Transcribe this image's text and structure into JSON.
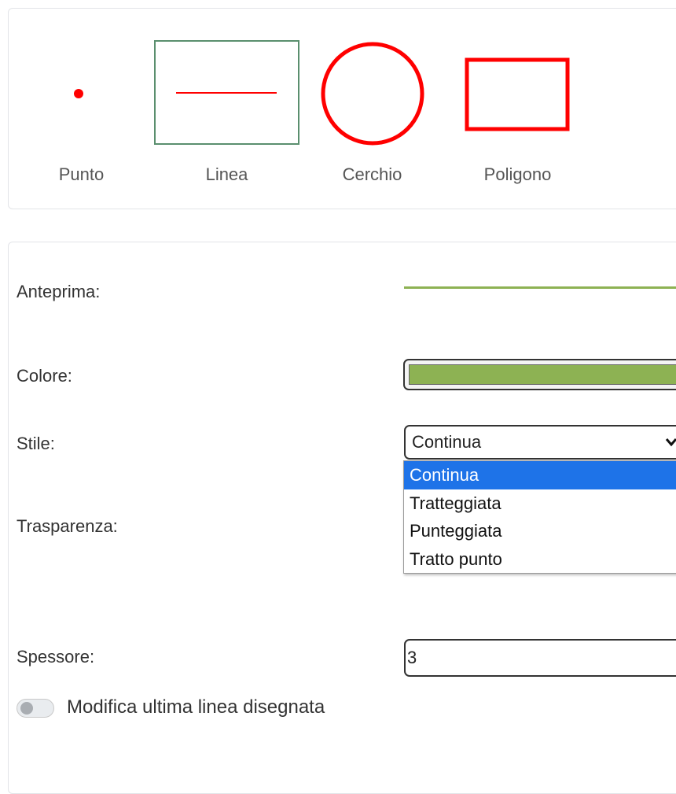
{
  "tools": {
    "items": [
      {
        "label": "Punto"
      },
      {
        "label": "Linea",
        "selected": true
      },
      {
        "label": "Cerchio"
      },
      {
        "label": "Poligono"
      }
    ]
  },
  "properties": {
    "preview_label": "Anteprima:",
    "color_label": "Colore:",
    "style_label": "Stile:",
    "transparency_label": "Trasparenza:",
    "thickness_label": "Spessore:",
    "line_color": "#8db253",
    "shape_color": "#ff0000",
    "style": {
      "selected": "Continua",
      "options": [
        "Continua",
        "Tratteggiata",
        "Punteggiata",
        "Tratto punto"
      ],
      "highlighted_index": 0
    },
    "thickness_value": "3",
    "toggle": {
      "label": "Modifica ultima linea disegnata",
      "checked": false
    }
  },
  "icons": {
    "dropdown": "chevron-down-icon"
  }
}
